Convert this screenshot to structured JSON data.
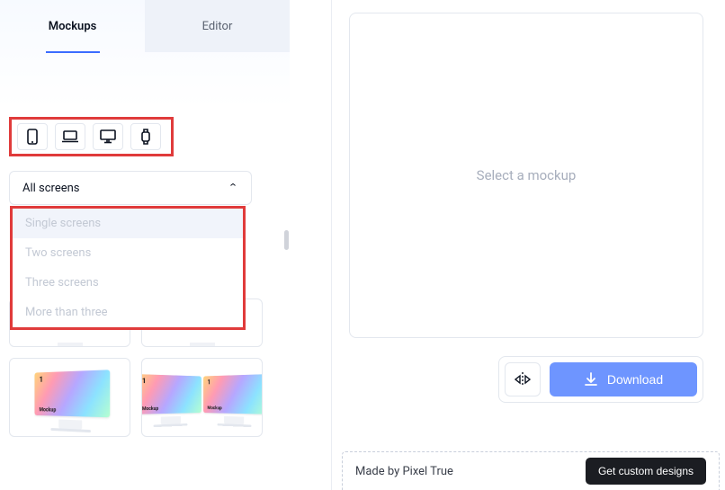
{
  "tabs": {
    "mockups": "Mockups",
    "editor": "Editor"
  },
  "devices": [
    "phone",
    "laptop",
    "desktop",
    "watch"
  ],
  "dropdown": {
    "selected": "All screens",
    "options": [
      "Single screens",
      "Two screens",
      "Three screens",
      "More than three"
    ]
  },
  "mockup_label": {
    "num": "1",
    "text": "Mockup"
  },
  "canvas": {
    "placeholder": "Select a mockup"
  },
  "actions": {
    "download": "Download"
  },
  "footer": {
    "made": "Made by Pixel True",
    "cta": "Get custom designs"
  }
}
